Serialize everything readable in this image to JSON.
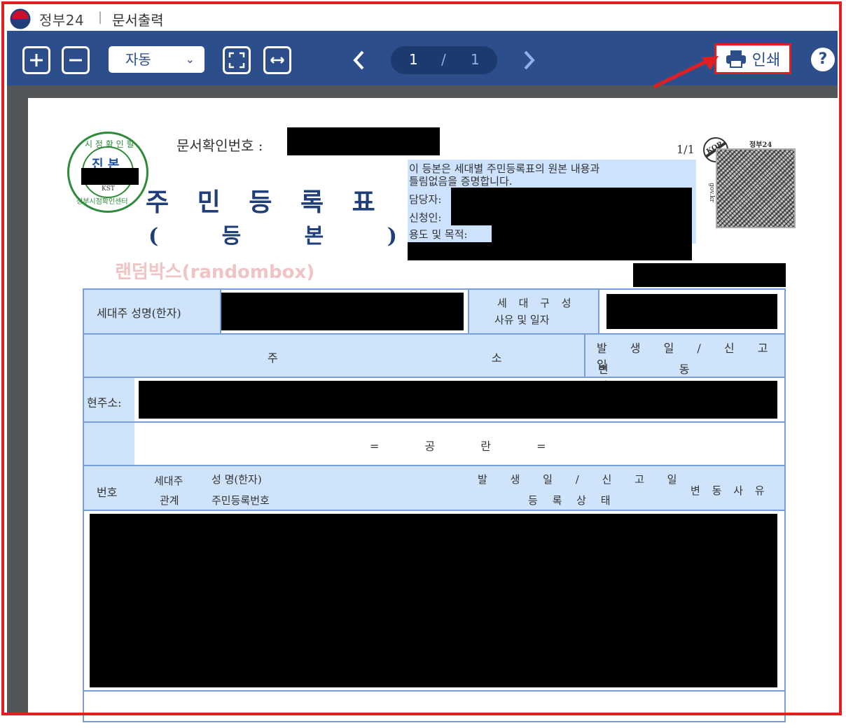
{
  "app": {
    "title": "정부24",
    "separator": "|",
    "window_title": "문서출력"
  },
  "toolbar": {
    "zoom_value": "자동",
    "page_current": "1",
    "page_sep": "/",
    "page_total": "1",
    "print_label": "인쇄",
    "help_label": "?"
  },
  "document": {
    "doc_no_label": "문서확인번호 :",
    "title_line1": "주 민 등 록 표",
    "title_line2": "( 등 본 )",
    "page_indicator": "1/1",
    "certify_line1": "이 등본은 세대별 주민등록표의 원본 내용과",
    "certify_line2": "틀림없음을 증명합니다.",
    "officer_label": "담당자:",
    "applicant_label": "신청인:",
    "purpose_label": "용도 및 목적:",
    "stamp_top": "시 정 확 인 필",
    "stamp_mid": "진 본",
    "stamp_code": "KST",
    "stamp_bottom": "정부시점확인센터",
    "qr_brand": "정부24",
    "qr_kor": "KOR",
    "qr_side": "gov.kr",
    "watermark": "랜덤박스(randombox)",
    "table": {
      "head_name": "세대주 성명(한자)",
      "head_reason_l1": "세 대 구 성",
      "head_reason_l2": "사유 및 일자",
      "addr_label": "주 소",
      "addr_date_l1": "발 생 일 / 신 고 일",
      "addr_date_l2": "변 동 사 유",
      "current_addr": "현주소:",
      "empty_mark": "= 공 란 =",
      "col_no": "번호",
      "col_rel_l1": "세대주",
      "col_rel_l2": "관계",
      "col_name_l1": "성 명(한자)",
      "col_name_l2": "주민등록번호",
      "col_date_l1": "발 생 일 / 신 고 일",
      "col_date_l2": "등 록 상 태",
      "col_reason": "변 동 사 유"
    }
  }
}
